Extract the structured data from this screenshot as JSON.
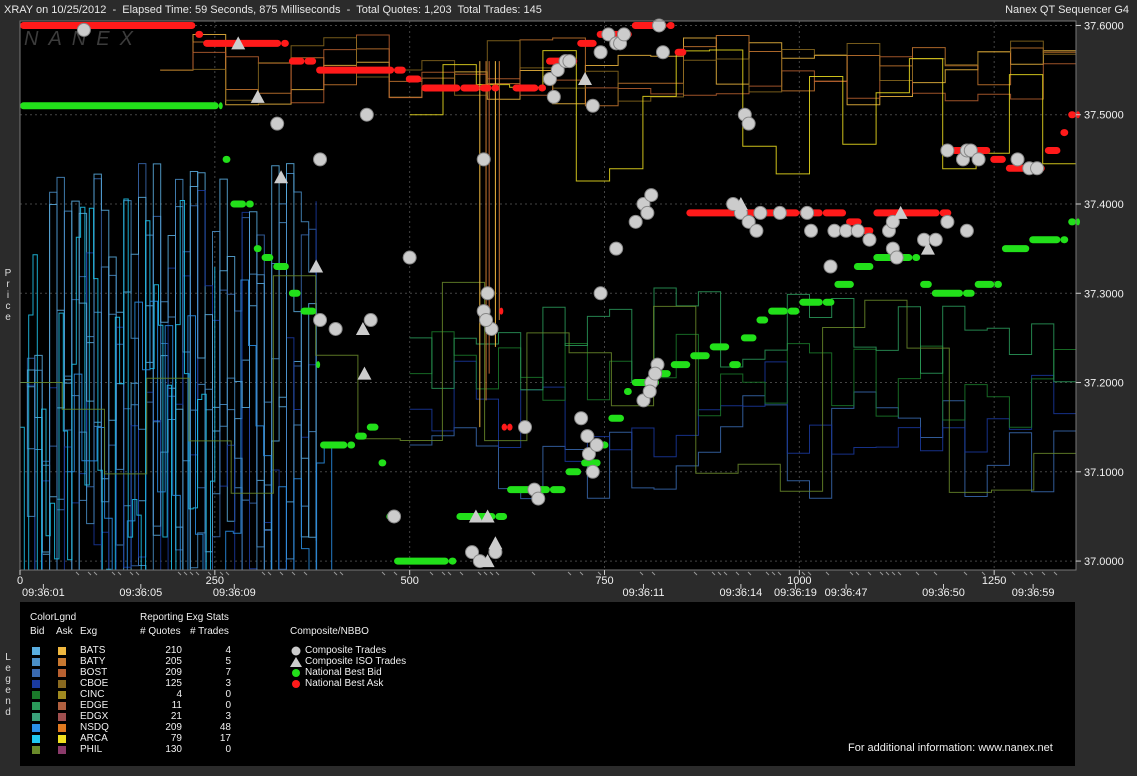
{
  "window": {
    "title_left": "XRAY on 10/25/2012  -  Elapsed Time: 59 Seconds, 875 Milliseconds  -  Total Quotes: 1,203  Total Trades: 145",
    "title_right": "Nanex QT Sequencer G4"
  },
  "watermark": "NANEX",
  "price_axis_label": "Price",
  "legend_axis_label": "Legend",
  "chart_data": {
    "type": "scatter",
    "x_ticks": [
      "0",
      "250",
      "500",
      "750",
      "1000",
      "1250"
    ],
    "x_tick_values": [
      0,
      250,
      500,
      750,
      1000,
      1250
    ],
    "xlim": [
      0,
      1355
    ],
    "ylim": [
      36.99,
      37.605
    ],
    "y_ticks": [
      "37.0000",
      "37.1000",
      "37.2000",
      "37.3000",
      "37.4000",
      "37.5000",
      "37.6000"
    ],
    "y_tick_values": [
      37.0,
      37.1,
      37.2,
      37.3,
      37.4,
      37.5,
      37.6
    ],
    "time_labels": [
      {
        "x": 30,
        "label": "09:36:01"
      },
      {
        "x": 155,
        "label": "09:36:05"
      },
      {
        "x": 275,
        "label": "09:36:09"
      },
      {
        "x": 800,
        "label": "09:36:11"
      },
      {
        "x": 925,
        "label": "09:36:14"
      },
      {
        "x": 995,
        "label": "09:36:19"
      },
      {
        "x": 1060,
        "label": "09:36:47"
      },
      {
        "x": 1185,
        "label": "09:36:50"
      },
      {
        "x": 1300,
        "label": "09:36:59"
      }
    ],
    "series": [
      {
        "name": "National Best Bid",
        "color": "#22e01a",
        "points": [
          [
            0,
            37.51
          ],
          [
            255,
            37.51
          ],
          [
            260,
            37.45
          ],
          [
            270,
            37.4
          ],
          [
            290,
            37.4
          ],
          [
            300,
            37.35
          ],
          [
            310,
            37.34
          ],
          [
            325,
            37.33
          ],
          [
            345,
            37.3
          ],
          [
            360,
            37.28
          ],
          [
            380,
            37.22
          ],
          [
            385,
            37.13
          ],
          [
            420,
            37.13
          ],
          [
            430,
            37.14
          ],
          [
            445,
            37.15
          ],
          [
            460,
            37.11
          ],
          [
            470,
            37.05
          ],
          [
            480,
            37.0
          ],
          [
            550,
            37.0
          ],
          [
            560,
            37.05
          ],
          [
            610,
            37.05
          ],
          [
            625,
            37.08
          ],
          [
            680,
            37.08
          ],
          [
            700,
            37.1
          ],
          [
            720,
            37.11
          ],
          [
            745,
            37.13
          ],
          [
            755,
            37.16
          ],
          [
            775,
            37.19
          ],
          [
            785,
            37.2
          ],
          [
            810,
            37.2
          ],
          [
            820,
            37.21
          ],
          [
            835,
            37.22
          ],
          [
            860,
            37.23
          ],
          [
            885,
            37.24
          ],
          [
            910,
            37.22
          ],
          [
            925,
            37.25
          ],
          [
            945,
            37.27
          ],
          [
            960,
            37.28
          ],
          [
            985,
            37.28
          ],
          [
            1000,
            37.29
          ],
          [
            1030,
            37.29
          ],
          [
            1045,
            37.31
          ],
          [
            1070,
            37.33
          ],
          [
            1095,
            37.34
          ],
          [
            1145,
            37.34
          ],
          [
            1155,
            37.31
          ],
          [
            1170,
            37.3
          ],
          [
            1210,
            37.3
          ],
          [
            1225,
            37.31
          ],
          [
            1250,
            37.31
          ],
          [
            1260,
            37.35
          ],
          [
            1295,
            37.36
          ],
          [
            1335,
            37.36
          ],
          [
            1345,
            37.38
          ],
          [
            1355,
            37.38
          ]
        ]
      },
      {
        "name": "National Best Ask",
        "color": "#ff1a1a",
        "points": [
          [
            0,
            37.6
          ],
          [
            225,
            37.59
          ],
          [
            235,
            37.58
          ],
          [
            335,
            37.58
          ],
          [
            345,
            37.56
          ],
          [
            365,
            37.56
          ],
          [
            380,
            37.55
          ],
          [
            480,
            37.55
          ],
          [
            495,
            37.54
          ],
          [
            515,
            37.53
          ],
          [
            565,
            37.53
          ],
          [
            590,
            37.53
          ],
          [
            605,
            37.53
          ],
          [
            615,
            37.28
          ],
          [
            618,
            37.15
          ],
          [
            625,
            37.15
          ],
          [
            632,
            37.53
          ],
          [
            665,
            37.53
          ],
          [
            675,
            37.56
          ],
          [
            700,
            37.56
          ],
          [
            715,
            37.58
          ],
          [
            740,
            37.59
          ],
          [
            775,
            37.59
          ],
          [
            785,
            37.6
          ],
          [
            830,
            37.6
          ],
          [
            840,
            37.57
          ],
          [
            855,
            37.39
          ],
          [
            1000,
            37.39
          ],
          [
            1030,
            37.39
          ],
          [
            1060,
            37.38
          ],
          [
            1080,
            37.37
          ],
          [
            1095,
            37.39
          ],
          [
            1180,
            37.39
          ],
          [
            1195,
            37.46
          ],
          [
            1225,
            37.46
          ],
          [
            1245,
            37.45
          ],
          [
            1265,
            37.44
          ],
          [
            1300,
            37.44
          ],
          [
            1315,
            37.46
          ],
          [
            1335,
            37.48
          ],
          [
            1345,
            37.5
          ],
          [
            1355,
            37.5
          ]
        ]
      },
      {
        "name": "Composite Trades",
        "color": "#cccccc",
        "points": [
          [
            82,
            37.595
          ],
          [
            330,
            37.49
          ],
          [
            385,
            37.45
          ],
          [
            445,
            37.5
          ],
          [
            385,
            37.27
          ],
          [
            405,
            37.26
          ],
          [
            450,
            37.27
          ],
          [
            500,
            37.34
          ],
          [
            480,
            37.05
          ],
          [
            595,
            37.45
          ],
          [
            600,
            37.3
          ],
          [
            595,
            37.28
          ],
          [
            605,
            37.26
          ],
          [
            598,
            37.27
          ],
          [
            648,
            37.15
          ],
          [
            580,
            37.01
          ],
          [
            590,
            37.0
          ],
          [
            610,
            37.01
          ],
          [
            660,
            37.08
          ],
          [
            665,
            37.07
          ],
          [
            720,
            37.16
          ],
          [
            728,
            37.14
          ],
          [
            730,
            37.12
          ],
          [
            735,
            37.1
          ],
          [
            740,
            37.13
          ],
          [
            745,
            37.3
          ],
          [
            765,
            37.35
          ],
          [
            790,
            37.38
          ],
          [
            800,
            37.4
          ],
          [
            810,
            37.41
          ],
          [
            805,
            37.39
          ],
          [
            818,
            37.22
          ],
          [
            810,
            37.2
          ],
          [
            800,
            37.18
          ],
          [
            808,
            37.19
          ],
          [
            815,
            37.21
          ],
          [
            685,
            37.52
          ],
          [
            680,
            37.54
          ],
          [
            690,
            37.55
          ],
          [
            700,
            37.56
          ],
          [
            705,
            37.56
          ],
          [
            735,
            37.51
          ],
          [
            745,
            37.57
          ],
          [
            755,
            37.59
          ],
          [
            765,
            37.58
          ],
          [
            770,
            37.58
          ],
          [
            775,
            37.59
          ],
          [
            820,
            37.6
          ],
          [
            825,
            37.57
          ],
          [
            930,
            37.5
          ],
          [
            935,
            37.49
          ],
          [
            915,
            37.4
          ],
          [
            925,
            37.39
          ],
          [
            935,
            37.38
          ],
          [
            945,
            37.37
          ],
          [
            950,
            37.39
          ],
          [
            975,
            37.39
          ],
          [
            1010,
            37.39
          ],
          [
            1015,
            37.37
          ],
          [
            1045,
            37.37
          ],
          [
            1060,
            37.37
          ],
          [
            1075,
            37.37
          ],
          [
            1090,
            37.36
          ],
          [
            1115,
            37.37
          ],
          [
            1120,
            37.38
          ],
          [
            1120,
            37.35
          ],
          [
            1125,
            37.34
          ],
          [
            1160,
            37.36
          ],
          [
            1175,
            37.36
          ],
          [
            1190,
            37.38
          ],
          [
            1215,
            37.37
          ],
          [
            1190,
            37.46
          ],
          [
            1210,
            37.45
          ],
          [
            1215,
            37.46
          ],
          [
            1220,
            37.46
          ],
          [
            1230,
            37.45
          ],
          [
            1280,
            37.45
          ],
          [
            1295,
            37.44
          ],
          [
            1305,
            37.44
          ],
          [
            1040,
            37.33
          ]
        ]
      },
      {
        "name": "Composite ISO Trades",
        "color": "#cccccc",
        "points": [
          [
            280,
            37.58
          ],
          [
            305,
            37.52
          ],
          [
            335,
            37.43
          ],
          [
            380,
            37.33
          ],
          [
            440,
            37.26
          ],
          [
            442,
            37.21
          ],
          [
            585,
            37.05
          ],
          [
            600,
            37.05
          ],
          [
            610,
            37.02
          ],
          [
            600,
            37.0
          ],
          [
            725,
            37.54
          ],
          [
            925,
            37.4
          ],
          [
            1130,
            37.39
          ],
          [
            1165,
            37.35
          ]
        ]
      }
    ]
  },
  "legend": {
    "colorlgnd": "ColorLgnd",
    "col_bid": "Bid",
    "col_ask": "Ask",
    "col_exg": "Exg",
    "stats_title": "Reporting Exg Stats",
    "col_quotes": "# Quotes",
    "col_trades": "# Trades",
    "composite_title": "Composite/NBBO",
    "rows": [
      {
        "exg": "BATS",
        "quotes": "210",
        "trades": "4",
        "bid_color": "#5aaee0",
        "ask_color": "#f0b840"
      },
      {
        "exg": "BATY",
        "quotes": "205",
        "trades": "5",
        "bid_color": "#4a8fc8",
        "ask_color": "#c87830"
      },
      {
        "exg": "BOST",
        "quotes": "209",
        "trades": "7",
        "bid_color": "#3a6ab0",
        "ask_color": "#b86030"
      },
      {
        "exg": "CBOE",
        "quotes": "125",
        "trades": "3",
        "bid_color": "#1a3aa0",
        "ask_color": "#8a6a20"
      },
      {
        "exg": "CINC",
        "quotes": "4",
        "trades": "0",
        "bid_color": "#1a7a2a",
        "ask_color": "#a08a20"
      },
      {
        "exg": "EDGE",
        "quotes": "11",
        "trades": "0",
        "bid_color": "#2a9a5a",
        "ask_color": "#b06040"
      },
      {
        "exg": "EDGX",
        "quotes": "21",
        "trades": "3",
        "bid_color": "#3aa07a",
        "ask_color": "#a05050"
      },
      {
        "exg": "NSDQ",
        "quotes": "209",
        "trades": "48",
        "bid_color": "#2a90e8",
        "ask_color": "#e07a20"
      },
      {
        "exg": "ARCA",
        "quotes": "79",
        "trades": "17",
        "bid_color": "#20c8f0",
        "ask_color": "#f0e020"
      },
      {
        "exg": "PHIL",
        "quotes": "130",
        "trades": "0",
        "bid_color": "#6a8a2a",
        "ask_color": "#8a3a6a"
      }
    ],
    "composite": [
      {
        "label": "Composite Trades",
        "marker": "circle",
        "color": "#cccccc"
      },
      {
        "label": "Composite ISO Trades",
        "marker": "triangle",
        "color": "#cccccc"
      },
      {
        "label": "National Best Bid",
        "marker": "dot",
        "color": "#22e01a"
      },
      {
        "label": "National Best Ask",
        "marker": "dot",
        "color": "#ff1a1a"
      }
    ],
    "footer": "For additional information: www.nanex.net"
  }
}
